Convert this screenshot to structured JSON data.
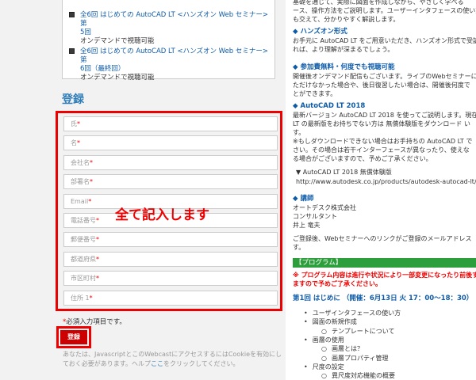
{
  "sessions": [
    {
      "title": "全6回 はじめての AutoCAD LT <ハンズオン Web セミナー> 第5回",
      "title_line1": "全6回 はじめての AutoCAD LT <ハンズオン Web セミナー> 第",
      "title_line2": "5回",
      "sub": "オンデマンドで視聴可能",
      "checked": true
    },
    {
      "title": "全6回 はじめての AutoCAD LT <ハンズオン Web セミナー> 第6回（最終回）",
      "title_line1": "全6回 はじめての AutoCAD LT <ハンズオン Web セミナー> 第",
      "title_line2": "6回（最終回）",
      "sub": "オンデマンドで視聴可能",
      "checked": true
    }
  ],
  "form": {
    "title": "登録",
    "fields": [
      {
        "label": "氏",
        "req": "*"
      },
      {
        "label": "名",
        "req": "*"
      },
      {
        "label": "会社名",
        "req": "*"
      },
      {
        "label": "部署名",
        "req": "*"
      },
      {
        "label": "Email",
        "req": "*"
      },
      {
        "label": "電話番号",
        "req": "*"
      },
      {
        "label": "郵便番号",
        "req": "*"
      },
      {
        "label": "都道府県",
        "req": "*"
      },
      {
        "label": "市区町村",
        "req": "*"
      },
      {
        "label": "住所 1",
        "req": "*"
      }
    ],
    "annotation": "全て記入します",
    "required_star": "*",
    "required_note": "必須入力項目です。",
    "submit_label": "登録",
    "cookie_note_1": "あなたは、JavascriptとこのWebcastにアクセスするにはCookieを有効にし",
    "cookie_note_2a": "ておく必要があります。ヘルプ",
    "cookie_note_link": "ここ",
    "cookie_note_2b": "をクリックしてください。"
  },
  "info": {
    "intro_1": "基礎を通じて、実際に図面を作成しながら、やさしく学べる",
    "intro_2": "ース、操作方法をご説明します。ユーザーインタフェースの使い方や用",
    "intro_3": "も交えて、分かりやすく解説します。",
    "hands_title": "◆ ハンズオン形式",
    "hands_1": "お手元に AutoCAD LT をご用意いただき、ハンズオン形式で受講",
    "hands_2": "れば、より理解が深まるでしょう。",
    "free_title": "◆ 参加費無料・何度でも視聴可能",
    "free_1": "開催後オンデマンド配信もございます。ライブのWebセミナーに",
    "free_2": "ただけなかった場合や、後日復習したい場合は、開催後何度で",
    "free_3": "とができます。",
    "lt_title": "◆ AutoCAD LT 2018",
    "lt_1": "最新バージョン AutoCAD LT 2018 を使ってご説明します。現在",
    "lt_2": "LT の最新版をお持ちでない方は 無償体験版をダウンロード い",
    "lt_3": "す。",
    "lt_4": "※もしダウンロードできない場合はお手持ちの AutoCAD LT で",
    "lt_5": "さい。その場合は若干インターフェースが異なったり、使えな",
    "lt_6": "る場合がございますので、予めご了承ください。",
    "trial_label": "▼ AutoCAD LT 2018 無償体験版",
    "trial_url": "http://www.autodesk.co.jp/products/autodesk-autocad-lt/free",
    "lecturer_title": "◆ 講師",
    "lecturer_1": "オートデスク株式会社",
    "lecturer_2": "コンサルタント",
    "lecturer_3": "井上 竜夫",
    "after_1": "ご登録後、Webセミナーへのリンクがご登録のメールアドレス",
    "after_2": "す。",
    "program_bar": "【プログラム】",
    "program_warn_1": "※ プログラム内容は進行や状況により一部変更になったり前後する",
    "program_warn_2": "ますので予めご了承ください。",
    "session1": "第1回 はじめに （開催：6月13日 火 17：00～18：30）",
    "items": [
      {
        "text": "ユーザインタフェースの使い方",
        "level": 1
      },
      {
        "text": "図面の新規作成",
        "level": 1
      },
      {
        "text": "テンプレートについて",
        "level": 2
      },
      {
        "text": "画層の使用",
        "level": 1
      },
      {
        "text": "画層とは？",
        "level": 2
      },
      {
        "text": "画層プロパティ管理",
        "level": 2
      },
      {
        "text": "尺度の設定",
        "level": 1
      },
      {
        "text": "異尺度対応機能の概要",
        "level": 2
      }
    ]
  },
  "colors": {
    "accent": "#2e7db8",
    "red": "#e00000",
    "green": "#2c9e3c"
  }
}
